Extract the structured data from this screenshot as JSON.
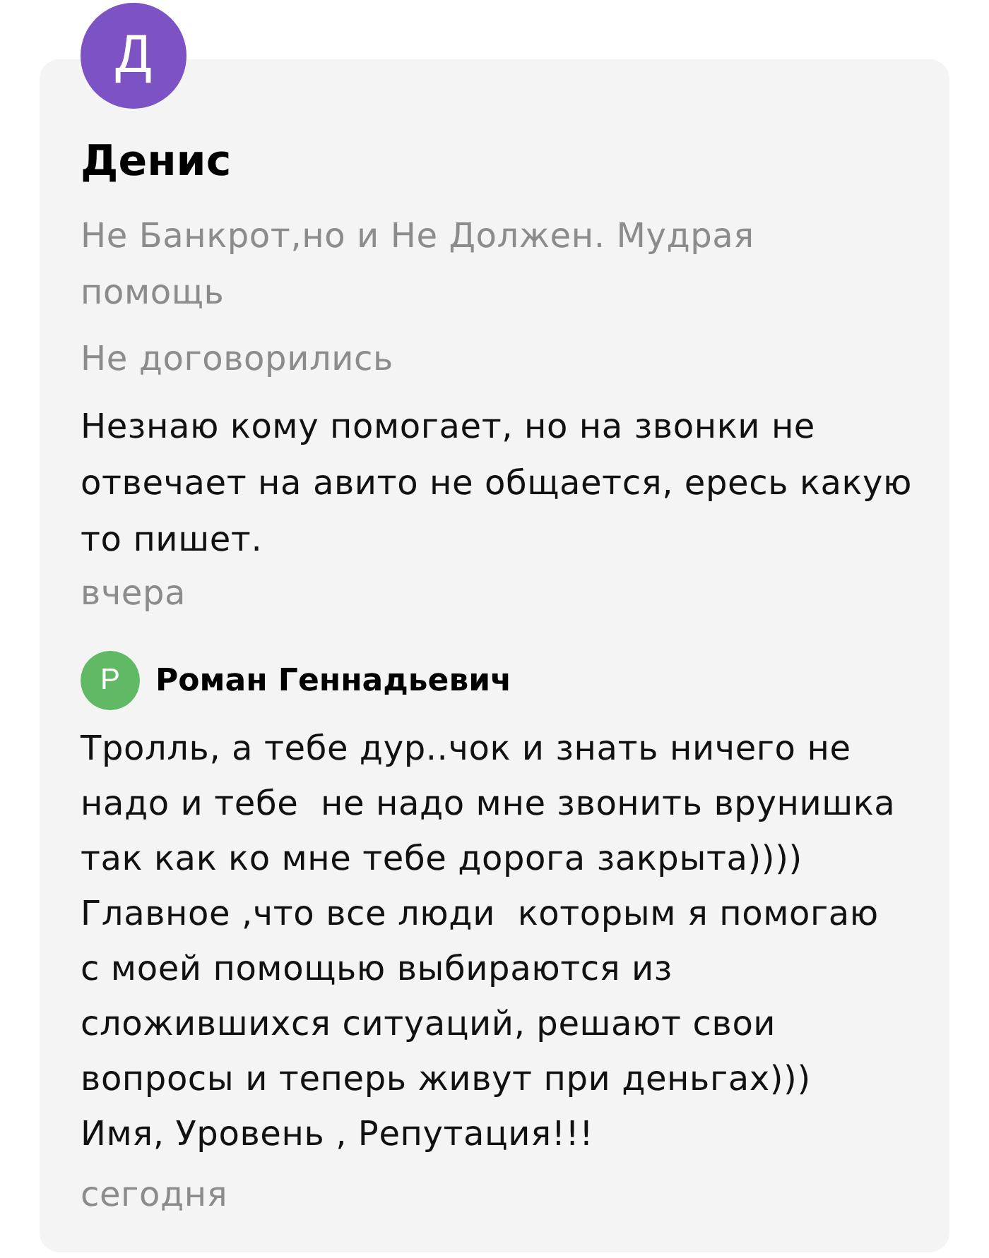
{
  "review": {
    "author_initial": "Д",
    "author_name": "Денис",
    "listing_title": "Не Банкрот,но и Не Должен. Мудрая помощь",
    "deal_status": "Не договорились",
    "text": "Незнаю кому помогает, но на звонки не отвечает на авито не общается, ересь какую то пишет.",
    "date": "вчера"
  },
  "reply": {
    "author_initial": "Р",
    "author_name": "Роман Геннадьевич",
    "text": "Тролль, а тебе дур..чок и знать ничего не надо и тебе  не надо мне звонить врунишка так как ко мне тебе дорога закрыта))))\nГлавное ,что все люди  которым я помогаю с моей помощью выбираются из сложившихся ситуаций, решают свои вопросы и теперь живут при деньгах)))  Имя, Уровень , Репутация!!!",
    "date": "сегодня"
  }
}
